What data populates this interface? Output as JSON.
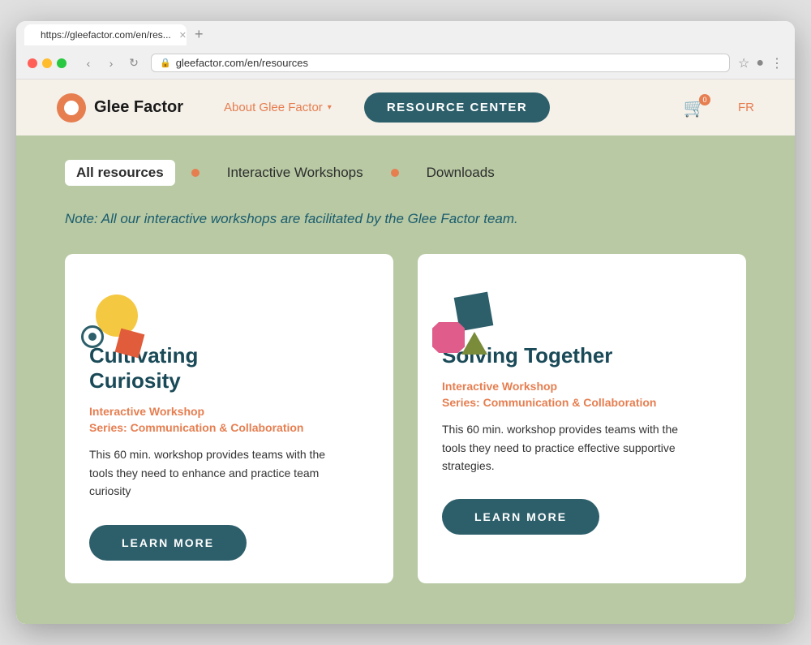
{
  "browser": {
    "url": "gleefactor.com/en/resources",
    "tab_title": "https://gleefactor.com/en/res...",
    "tab_favicon": "glee-factor-favicon"
  },
  "header": {
    "logo_text": "Glee Factor",
    "nav_about": "About Glee Factor",
    "resource_center_label": "RESOURCE CENTER",
    "cart_count": "0",
    "lang": "FR"
  },
  "filter_tabs": {
    "all_resources": "All resources",
    "interactive_workshops": "Interactive Workshops",
    "downloads": "Downloads"
  },
  "note": "Note: All our interactive workshops are facilitated by the Glee Factor team.",
  "cards": [
    {
      "title": "Cultivating Curiosity",
      "type": "Interactive Workshop",
      "series": "Series: Communication & Collaboration",
      "description": "This 60 min. workshop provides teams with the tools they need to enhance and practice team curiosity",
      "btn_label": "LEARN MORE"
    },
    {
      "title": "Solving Together",
      "type": "Interactive Workshop",
      "series": "Series: Communication & Collaboration",
      "description": "This 60 min. workshop provides teams with the tools they need to practice effective supportive strategies.",
      "btn_label": "LEARN MORE"
    }
  ]
}
